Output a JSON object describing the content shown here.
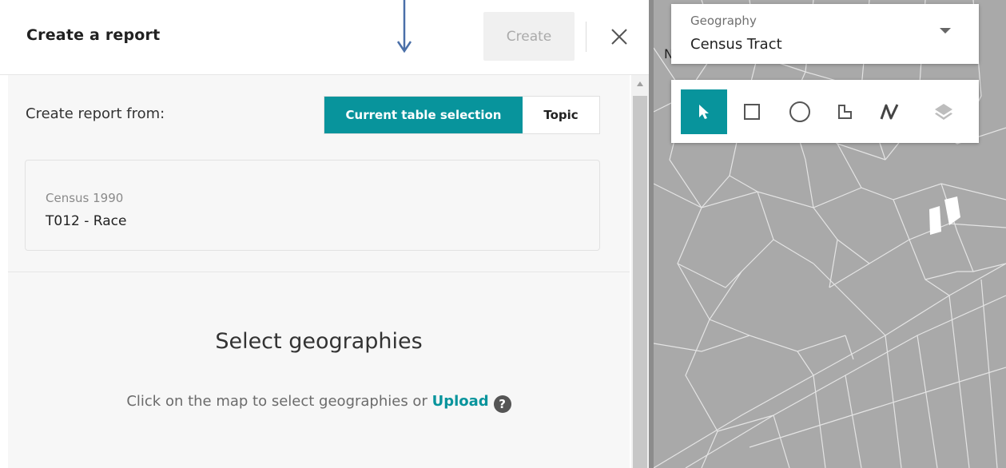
{
  "panel": {
    "title": "Create a report",
    "create_label": "Create",
    "from_label": "Create report from:",
    "segments": [
      {
        "label": "Current table selection",
        "active": true
      },
      {
        "label": "Topic",
        "active": false
      }
    ],
    "selection_card": {
      "dataset": "Census 1990",
      "table": "T012 - Race"
    },
    "select_section": {
      "title": "Select geographies",
      "hint_prefix": "Click on the map to select geographies or ",
      "upload_label": "Upload",
      "help_symbol": "?"
    }
  },
  "map": {
    "peek_text": "N",
    "geography": {
      "label": "Geography",
      "value": "Census Tract"
    },
    "tools": [
      {
        "name": "pointer-select-icon",
        "active": true
      },
      {
        "name": "rectangle-select-icon",
        "active": false
      },
      {
        "name": "circle-select-icon",
        "active": false
      },
      {
        "name": "polygon-select-icon",
        "active": false
      },
      {
        "name": "line-select-icon",
        "active": false
      },
      {
        "name": "layers-icon",
        "active": false
      }
    ]
  },
  "colors": {
    "accent": "#08949c",
    "map_fill": "#a9a9a9",
    "annotation_arrow": "#4a6fa8"
  }
}
